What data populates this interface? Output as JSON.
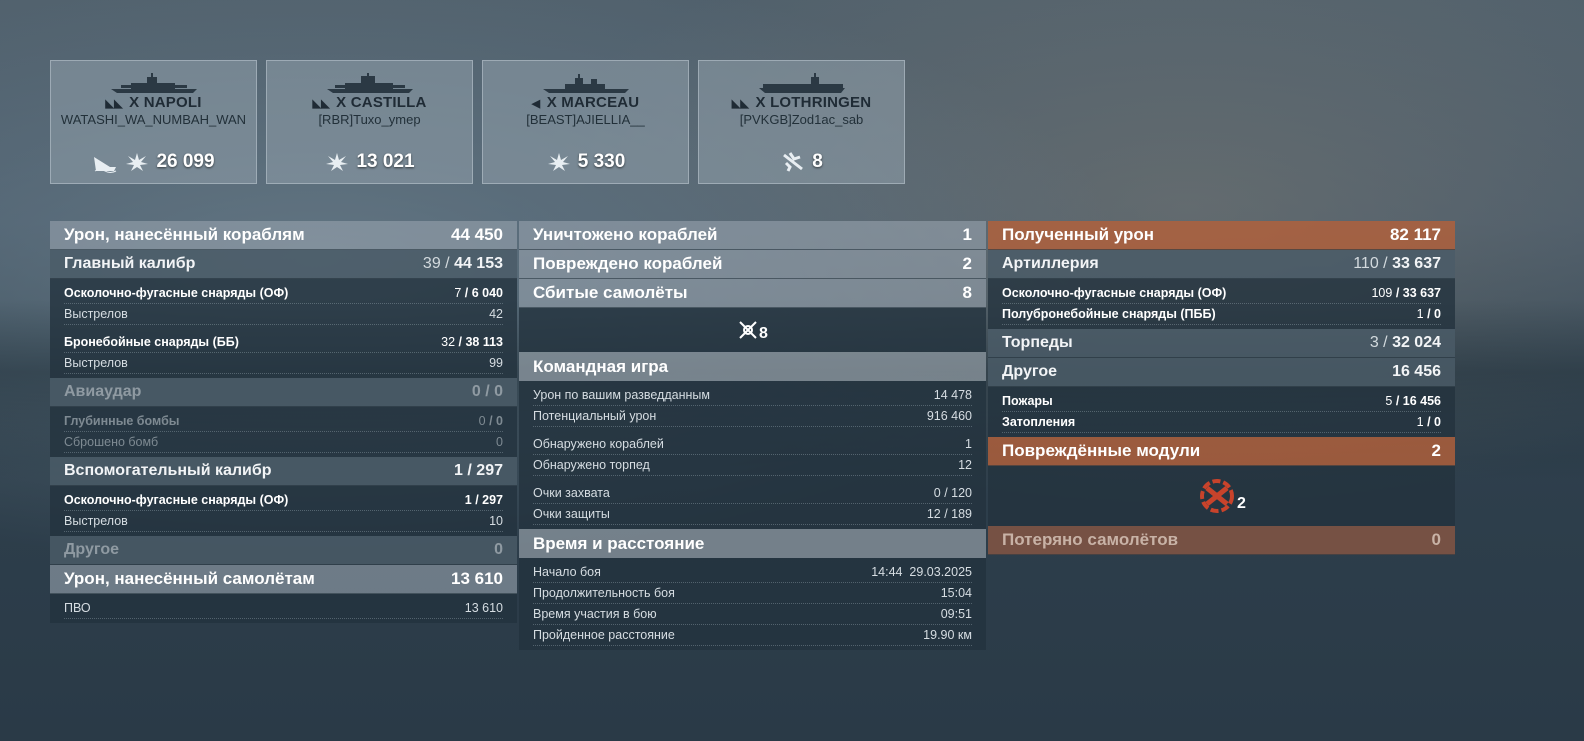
{
  "ships": [
    {
      "tier": "X",
      "name": "NAPOLI",
      "player": "WATASHI_WA_NUMBAH_WAN",
      "icons": [
        "ship-sunk-icon",
        "damage-burst-icon"
      ],
      "value": "26 099"
    },
    {
      "tier": "X",
      "name": "CASTILLA",
      "player": "[RBR]Tuxo_ymep",
      "icons": [
        "damage-burst-icon"
      ],
      "value": "13 021"
    },
    {
      "tier": "X",
      "name": "MARCEAU",
      "player": "[BEAST]AJIELLIA__",
      "icons": [
        "damage-burst-icon"
      ],
      "value": "5 330"
    },
    {
      "tier": "X",
      "name": "LOTHRINGEN",
      "player": "[PVKGB]Zod1ac_sab",
      "icons": [
        "plane-shot-icon"
      ],
      "value": "8"
    }
  ],
  "left": {
    "ship_damage": {
      "label": "Урон, нанесённый кораблям",
      "value": "44 450"
    },
    "main_battery": {
      "label": "Главный калибр",
      "hits": "39",
      "dmg": "44 153"
    },
    "he_shells": {
      "label": "Осколочно-фугасные снаряды (ОФ)",
      "hits": "7",
      "dmg": "6 040"
    },
    "he_shots": {
      "label": "Выстрелов",
      "value": "42"
    },
    "ap_shells": {
      "label": "Бронебойные снаряды (ББ)",
      "hits": "32",
      "dmg": "38 113"
    },
    "ap_shots": {
      "label": "Выстрелов",
      "value": "99"
    },
    "airstrike": {
      "label": "Авиаудар",
      "hits": "0",
      "dmg": "0"
    },
    "depth_charges": {
      "label": "Глубинные бомбы",
      "hits": "0",
      "dmg": "0"
    },
    "bombs_dropped": {
      "label": "Сброшено бомб",
      "value": "0"
    },
    "secondary": {
      "label": "Вспомогательный калибр",
      "hits": "1",
      "dmg": "297"
    },
    "sec_he": {
      "label": "Осколочно-фугасные снаряды (ОФ)",
      "hits": "1",
      "dmg": "297"
    },
    "sec_shots": {
      "label": "Выстрелов",
      "value": "10"
    },
    "other": {
      "label": "Другое",
      "value": "0"
    },
    "plane_damage": {
      "label": "Урон, нанесённый самолётам",
      "value": "13 610"
    },
    "aa": {
      "label": "ПВО",
      "value": "13 610"
    }
  },
  "middle": {
    "destroyed": {
      "label": "Уничтожено кораблей",
      "value": "1"
    },
    "damaged": {
      "label": "Повреждено кораблей",
      "value": "2"
    },
    "planes_shot": {
      "label": "Сбитые самолёты",
      "value": "8"
    },
    "planes_icon_count": "8",
    "team_title": "Командная игра",
    "spotting_damage": {
      "label": "Урон по вашим разведданным",
      "value": "14 478"
    },
    "potential_damage": {
      "label": "Потенциальный урон",
      "value": "916 460"
    },
    "ships_spotted": {
      "label": "Обнаружено кораблей",
      "value": "1"
    },
    "torps_spotted": {
      "label": "Обнаружено торпед",
      "value": "12"
    },
    "capture": {
      "label": "Очки захвата",
      "value": "0 / 120"
    },
    "defense": {
      "label": "Очки защиты",
      "value": "12 / 189"
    },
    "time_title": "Время и расстояние",
    "battle_start": {
      "label": "Начало боя",
      "value": "14:44  29.03.2025"
    },
    "duration": {
      "label": "Продолжительность боя",
      "value": "15:04"
    },
    "participation": {
      "label": "Время участия в бою",
      "value": "09:51"
    },
    "distance": {
      "label": "Пройденное расстояние",
      "value": "19.90 км"
    }
  },
  "right": {
    "received": {
      "label": "Полученный урон",
      "value": "82 117"
    },
    "artillery": {
      "label": "Артиллерия",
      "hits": "110",
      "dmg": "33 637"
    },
    "he": {
      "label": "Осколочно-фугасные снаряды (ОФ)",
      "hits": "109",
      "dmg": "33 637"
    },
    "sap": {
      "label": "Полубронебойные снаряды (ПББ)",
      "hits": "1",
      "dmg": "0"
    },
    "torpedoes": {
      "label": "Торпеды",
      "hits": "3",
      "dmg": "32 024"
    },
    "other": {
      "label": "Другое",
      "value": "16 456"
    },
    "fires": {
      "label": "Пожары",
      "hits": "5",
      "dmg": "16 456"
    },
    "flooding": {
      "label": "Затопления",
      "hits": "1",
      "dmg": "0"
    },
    "modules": {
      "label": "Повреждённые модули",
      "value": "2"
    },
    "modules_icon_count": "2",
    "planes_lost": {
      "label": "Потеряно самолётов",
      "value": "0"
    }
  }
}
